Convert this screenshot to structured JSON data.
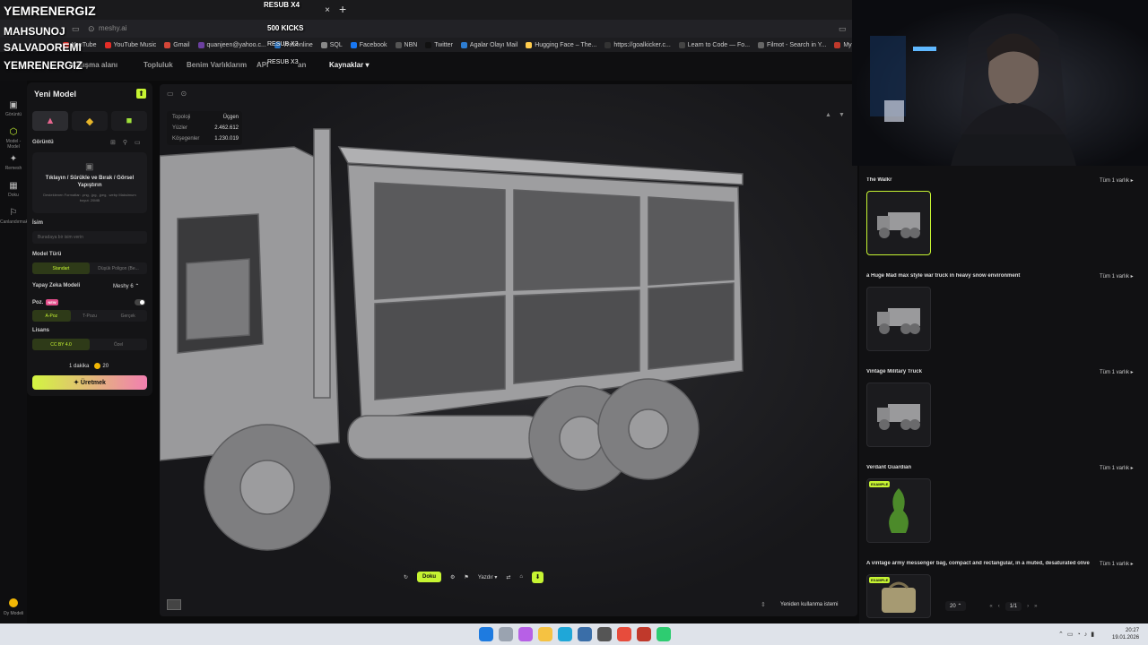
{
  "overlays": {
    "main": "YEMRENERGIZ",
    "line1": "MAHSUNOJ",
    "line2": "SALVADOREMI",
    "line3": "YEMRENERGIZ",
    "resub_x4": "RESUB X4",
    "kicks": "500 KICKS",
    "resub_x3a": "RESUB X3",
    "resub_x3b": "RESUB X3"
  },
  "browser": {
    "tab_close": "×",
    "new_tab": "+",
    "url": "meshy.ai",
    "bookmarks": [
      {
        "label": "YouTube",
        "color": "#e52d27"
      },
      {
        "label": "YouTube Music",
        "color": "#e52d27"
      },
      {
        "label": "Gmail",
        "color": "#d44638"
      },
      {
        "label": "quanjeen@yahoo.c...",
        "color": "#6b3fa0"
      },
      {
        "label": "Webonline",
        "color": "#2d7dd2"
      },
      {
        "label": "SQL",
        "color": "#888888"
      },
      {
        "label": "Facebook",
        "color": "#1877f2"
      },
      {
        "label": "NBN",
        "color": "#555555"
      },
      {
        "label": "Twitter",
        "color": "#111111"
      },
      {
        "label": "Agalar Olayı Mail",
        "color": "#2d7dd2"
      },
      {
        "label": "Hugging Face – The...",
        "color": "#ffcc4d"
      },
      {
        "label": "https://goalkicker.c...",
        "color": "#333333"
      },
      {
        "label": "Learn to Code — Fo...",
        "color": "#444444"
      },
      {
        "label": "Filmot - Search in Y...",
        "color": "#666666"
      },
      {
        "label": "Myinstants | The lar",
        "color": "#c0392b"
      }
    ]
  },
  "nav": {
    "calisma": "Çalışma alanı",
    "topluluk": "Topluluk",
    "varliklar": "Benim Varlıklarım",
    "api": "API",
    "plan": "an",
    "kaynaklar": "Kaynaklar ▾"
  },
  "rail": [
    {
      "icon": "▣",
      "label": "Görüntü"
    },
    {
      "icon": "⬡",
      "label": "Model - Model"
    },
    {
      "icon": "✦",
      "label": "Remesh"
    },
    {
      "icon": "▦",
      "label": "Doku"
    },
    {
      "icon": "⚐",
      "label": "Canlandırmak"
    }
  ],
  "rail_bottom": "Oy Modeli",
  "panel": {
    "title": "Yeni Model",
    "gorunt": "Görüntü",
    "drop_title": "Tıklayın / Sürükle ve Bırak / Görsel Yapıştırın",
    "drop_hint": "Desteklenen Formatlar: .png, .jpg, .jpeg, .webp Maksimum boyut: 20MB",
    "isim": "İsim",
    "isim_placeholder": "Buradaya bir isim verin",
    "model_turu": "Model Türü",
    "mt_opts": [
      "Standart",
      "Düşük Poligon (Be..."
    ],
    "yz_model": "Yapay Zeka Modeli",
    "yz_value": "Meshy 6 ⌃",
    "poz": "Poz.",
    "new": "NEW",
    "poz_opts": [
      "A-Poz",
      "T-Pozu",
      "Gerçek"
    ],
    "lisans": "Lisans",
    "lis_opts": [
      "CC BY 4.0",
      "Özel"
    ],
    "time": "1 dakika",
    "cost": "20",
    "generate": "Üretmek"
  },
  "stats": {
    "topo_k": "Topoloji",
    "topo_v": "Üçgen",
    "faces_k": "Yüzler",
    "faces_v": "2.462.612",
    "verts_k": "Köşegenler",
    "verts_v": "1.230.019"
  },
  "toolbar": {
    "doku": "Doku",
    "yazdir": "Yazdır ▾"
  },
  "viewport": {
    "reuse": "Yeniden kullanma istemi"
  },
  "assets": [
    {
      "title": "The Walkr",
      "more": "Tüm 1 varlık ▸",
      "example": false
    },
    {
      "title": "a Huge Mad max style war truck in heavy snow environment",
      "more": "Tüm 1 varlık ▸",
      "example": false
    },
    {
      "title": "Vintage Military Truck",
      "more": "Tüm 1 varlık ▸",
      "example": false
    },
    {
      "title": "Verdant Guardian",
      "more": "Tüm 1 varlık ▸",
      "example": true
    },
    {
      "title": "A vintage army messenger bag, compact and rectangular, in a muted, desaturated olive g...",
      "more": "Tüm 1 varlık ▸",
      "example": true
    }
  ],
  "example_label": "EXAMPLE",
  "pager": {
    "per_page": "20 ⌃",
    "page": "1/1"
  },
  "clock": {
    "time": "20:27",
    "date": "19.01.2026"
  }
}
